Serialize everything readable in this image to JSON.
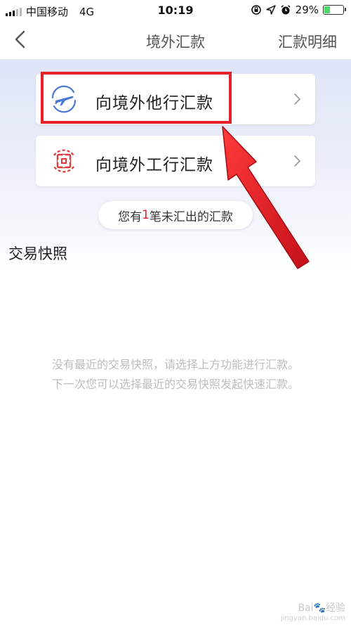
{
  "status_bar": {
    "carrier": "中国移动",
    "network": "4G",
    "time": "10:19",
    "battery": "29%"
  },
  "nav": {
    "title": "境外汇款",
    "detail_link": "汇款明细"
  },
  "options": [
    {
      "label": "向境外他行汇款",
      "icon": "plane-icon",
      "icon_color": "#4a78d6"
    },
    {
      "label": "向境外工行汇款",
      "icon": "icbc-logo-icon",
      "icon_color": "#e03b3b"
    }
  ],
  "pending": {
    "prefix": "您有",
    "count": "1",
    "suffix": "笔未汇出的汇款"
  },
  "section": {
    "title": "交易快照"
  },
  "empty_state": {
    "line1": "没有最近的交易快照，请选择上方功能进行汇款。",
    "line2": "下一次您可以选择最近的交易快照发起快速汇款。"
  },
  "watermark": {
    "brand": "Bai",
    "brand_suffix": "经验",
    "url": "jingyan.baidu.com"
  },
  "colors": {
    "accent_red": "#e8202a",
    "hero_bg": "#dfe5f7"
  }
}
